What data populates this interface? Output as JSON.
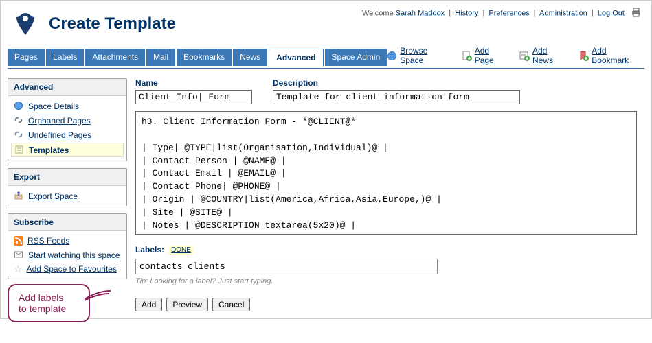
{
  "header": {
    "title": "Create Template",
    "welcome_prefix": "Welcome ",
    "username": "Sarah Maddox",
    "links": {
      "history": "History",
      "preferences": "Preferences",
      "administration": "Administration",
      "logout": "Log Out"
    }
  },
  "tabs": {
    "pages": "Pages",
    "labels": "Labels",
    "attachments": "Attachments",
    "mail": "Mail",
    "bookmarks": "Bookmarks",
    "news": "News",
    "advanced": "Advanced",
    "space_admin": "Space Admin"
  },
  "actions": {
    "browse": "Browse Space",
    "add_page": "Add Page",
    "add_news": "Add News",
    "add_bookmark": "Add Bookmark"
  },
  "sidebar": {
    "advanced": {
      "heading": "Advanced",
      "space_details": "Space Details",
      "orphaned": "Orphaned Pages",
      "undefined": "Undefined Pages",
      "templates": "Templates"
    },
    "export": {
      "heading": "Export",
      "export_space": "Export Space"
    },
    "subscribe": {
      "heading": "Subscribe",
      "rss": "RSS Feeds",
      "watch": "Start watching this space",
      "favourite": "Add Space to Favourites"
    }
  },
  "form": {
    "name_label": "Name",
    "name_value": "Client Info| Form",
    "desc_label": "Description",
    "desc_value": "Template for client information form",
    "body": "h3. Client Information Form - *@CLIENT@*\n\n| Type| @TYPE|list(Organisation,Individual)@ |\n| Contact Person | @NAME@ |\n| Contact Email | @EMAIL@ |\n| Contact Phone| @PHONE@ |\n| Origin | @COUNTRY|list(America,Africa,Asia,Europe,)@ |\n| Site | @SITE@ |\n| Notes | @DESCRIPTION|textarea(5x20)@ |",
    "labels_label": "Labels:",
    "labels_done": "DONE",
    "labels_value": "contacts clients",
    "tip_prefix": "Tip: ",
    "tip_text": "Looking for a label? Just start typing.",
    "buttons": {
      "add": "Add",
      "preview": "Preview",
      "cancel": "Cancel"
    }
  },
  "callout": {
    "line1": "Add labels",
    "line2": "to template"
  }
}
